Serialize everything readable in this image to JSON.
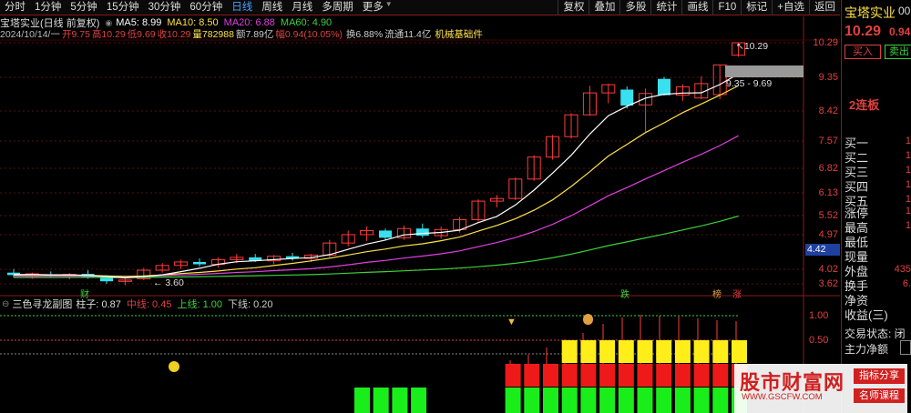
{
  "toolbar": {
    "periods": [
      "分时",
      "1分钟",
      "5分钟",
      "15分钟",
      "30分钟",
      "60分钟",
      "日线",
      "周线",
      "月线",
      "多周期",
      "更多"
    ],
    "active_period": "日线",
    "right_buttons": [
      "复权",
      "叠加",
      "多股",
      "统计",
      "画线",
      "F10",
      "标记",
      "+自选",
      "返回"
    ]
  },
  "title": {
    "stock": "宝塔实业(日线 前复权)",
    "ma5_label": "MA5: 8.99",
    "ma10_label": "MA10: 8.50",
    "ma20_label": "MA20: 6.88",
    "ma60_label": "MA60: 4.90"
  },
  "info": {
    "date": "2024/10/14/一",
    "open": "开9.75",
    "high": "高10.29",
    "low": "低9.69",
    "close": "收10.29",
    "volume": "量782988",
    "amount": "额7.89亿",
    "change": "幅0.94(10.05%)",
    "turnover": "换6.88%",
    "float": "流通11.4亿",
    "sector": "机械基础件"
  },
  "price_axis": [
    "10.29",
    "9.35",
    "8.42",
    "7.57",
    "6.82",
    "6.13",
    "5.52",
    "4.97",
    "4.42",
    "4.02",
    "3.62"
  ],
  "annotations": {
    "high_marker": "10.29",
    "low_marker": "3.60",
    "range_label": "9.35 - 9.69",
    "current_price_tag": "4.42",
    "event_fin": "财",
    "event_drop": "跌",
    "event_news": "榜",
    "event_rise": "涨"
  },
  "sub_indicator": {
    "name": "三色寻龙副图",
    "zhuzi": "柱子: 0.87",
    "zhongxian": "中线: 0.45",
    "shangxian": "上线: 1.00",
    "xiaxian": "下线: 0.20",
    "axis": [
      "1.00",
      "0.50"
    ]
  },
  "right_panel": {
    "stock_name": "宝塔实业",
    "stock_code": "00",
    "price": "10.29",
    "change_short": "0.94",
    "buy_button": "买入",
    "sell_button": "卖出",
    "streak": "2连板",
    "buy_levels": [
      {
        "label": "买一",
        "val": "1"
      },
      {
        "label": "买二",
        "val": "1"
      },
      {
        "label": "买三",
        "val": "1"
      },
      {
        "label": "买四",
        "val": "1"
      },
      {
        "label": "买五",
        "val": "1"
      }
    ],
    "stats": [
      {
        "label": "涨停",
        "val": "1"
      },
      {
        "label": "最高",
        "val": "1"
      },
      {
        "label": "最低",
        "val": ""
      },
      {
        "label": "现量",
        "val": ""
      },
      {
        "label": "外盘",
        "val": "435"
      },
      {
        "label": "换手",
        "val": "6."
      },
      {
        "label": "净资",
        "val": ""
      },
      {
        "label": "收益(三)",
        "val": ""
      }
    ],
    "trade_status": "交易状态: 闭",
    "main_flow": "主力净额"
  },
  "watermark": {
    "site_name": "股市财富网",
    "url": "WWW.GSCFW.COM",
    "tag1": "指标分享",
    "tag2": "名师课程"
  },
  "chart_data": {
    "type": "candlestick",
    "candles": [
      {
        "o": 3.8,
        "h": 3.86,
        "l": 3.72,
        "c": 3.76
      },
      {
        "o": 3.74,
        "h": 3.8,
        "l": 3.7,
        "c": 3.78
      },
      {
        "o": 3.77,
        "h": 3.82,
        "l": 3.72,
        "c": 3.74
      },
      {
        "o": 3.74,
        "h": 3.79,
        "l": 3.69,
        "c": 3.77
      },
      {
        "o": 3.78,
        "h": 3.84,
        "l": 3.7,
        "c": 3.72
      },
      {
        "o": 3.72,
        "h": 3.76,
        "l": 3.62,
        "c": 3.66
      },
      {
        "o": 3.66,
        "h": 3.7,
        "l": 3.6,
        "c": 3.68
      },
      {
        "o": 3.7,
        "h": 3.88,
        "l": 3.68,
        "c": 3.84
      },
      {
        "o": 3.84,
        "h": 3.96,
        "l": 3.8,
        "c": 3.92
      },
      {
        "o": 3.92,
        "h": 4.02,
        "l": 3.86,
        "c": 3.98
      },
      {
        "o": 3.98,
        "h": 4.04,
        "l": 3.9,
        "c": 3.94
      },
      {
        "o": 3.94,
        "h": 4.06,
        "l": 3.88,
        "c": 4.02
      },
      {
        "o": 4.02,
        "h": 4.12,
        "l": 3.96,
        "c": 4.06
      },
      {
        "o": 4.06,
        "h": 4.12,
        "l": 3.98,
        "c": 4.0
      },
      {
        "o": 4.0,
        "h": 4.1,
        "l": 3.94,
        "c": 4.08
      },
      {
        "o": 4.08,
        "h": 4.14,
        "l": 4.0,
        "c": 4.04
      },
      {
        "o": 4.04,
        "h": 4.12,
        "l": 3.98,
        "c": 4.1
      },
      {
        "o": 4.1,
        "h": 4.38,
        "l": 4.06,
        "c": 4.32
      },
      {
        "o": 4.32,
        "h": 4.56,
        "l": 4.26,
        "c": 4.48
      },
      {
        "o": 4.48,
        "h": 4.64,
        "l": 4.36,
        "c": 4.56
      },
      {
        "o": 4.56,
        "h": 4.6,
        "l": 4.38,
        "c": 4.42
      },
      {
        "o": 4.42,
        "h": 4.66,
        "l": 4.38,
        "c": 4.6
      },
      {
        "o": 4.6,
        "h": 4.7,
        "l": 4.42,
        "c": 4.46
      },
      {
        "o": 4.46,
        "h": 4.64,
        "l": 4.4,
        "c": 4.58
      },
      {
        "o": 4.58,
        "h": 4.84,
        "l": 4.52,
        "c": 4.78
      },
      {
        "o": 4.78,
        "h": 5.22,
        "l": 4.74,
        "c": 5.18
      },
      {
        "o": 5.18,
        "h": 5.32,
        "l": 5.04,
        "c": 5.24
      },
      {
        "o": 5.24,
        "h": 5.74,
        "l": 5.2,
        "c": 5.7
      },
      {
        "o": 5.7,
        "h": 6.32,
        "l": 5.66,
        "c": 6.27
      },
      {
        "o": 6.27,
        "h": 6.9,
        "l": 6.2,
        "c": 6.85
      },
      {
        "o": 6.85,
        "h": 7.58,
        "l": 6.8,
        "c": 7.53
      },
      {
        "o": 7.53,
        "h": 8.54,
        "l": 7.5,
        "c": 8.28
      },
      {
        "o": 8.28,
        "h": 8.62,
        "l": 7.92,
        "c": 8.58
      },
      {
        "o": 8.4,
        "h": 8.52,
        "l": 7.74,
        "c": 7.84
      },
      {
        "o": 7.86,
        "h": 8.44,
        "l": 7.0,
        "c": 8.26
      },
      {
        "o": 8.8,
        "h": 8.88,
        "l": 8.18,
        "c": 8.2
      },
      {
        "o": 8.2,
        "h": 8.6,
        "l": 8.0,
        "c": 8.5
      },
      {
        "o": 8.1,
        "h": 8.9,
        "l": 8.06,
        "c": 8.62
      },
      {
        "o": 8.22,
        "h": 9.35,
        "l": 8.06,
        "c": 9.35
      },
      {
        "o": 9.75,
        "h": 10.29,
        "l": 9.69,
        "c": 10.29
      }
    ],
    "ma5_end": 8.99,
    "ma10_end": 8.5,
    "ma20_end": 6.88,
    "ma60_end": 4.9,
    "bars": {
      "green": [
        1,
        1,
        1,
        1,
        0,
        0,
        0,
        0,
        1,
        1,
        1,
        1,
        1,
        1,
        1,
        1,
        1,
        1,
        1,
        1,
        1
      ],
      "red": [
        0,
        0,
        0,
        0,
        0,
        0,
        0,
        0,
        1,
        1,
        1,
        1,
        1,
        1,
        1,
        1,
        1,
        1,
        1,
        1,
        1
      ],
      "yellow": [
        0,
        0,
        0,
        0,
        0,
        0,
        0,
        0,
        0,
        0,
        0,
        1,
        1,
        1,
        1,
        1,
        1,
        1,
        1,
        1,
        1
      ]
    }
  }
}
